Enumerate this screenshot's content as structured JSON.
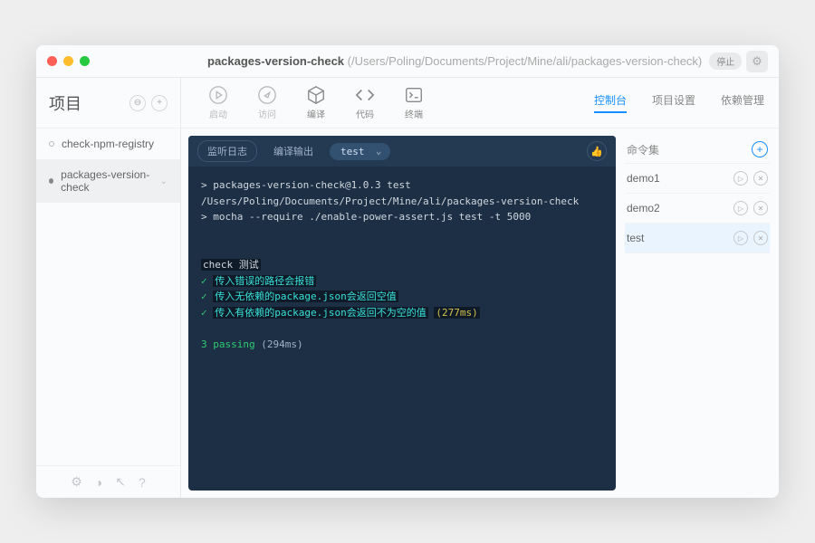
{
  "titlebar": {
    "name": "packages-version-check",
    "path": "(/Users/Poling/Documents/Project/Mine/ali/packages-version-check)",
    "stop": "停止"
  },
  "sidebar": {
    "title": "项目",
    "projects": [
      {
        "name": "check-npm-registry"
      },
      {
        "name": "packages-version-check"
      }
    ]
  },
  "toolbar": {
    "items": [
      {
        "label": "启动"
      },
      {
        "label": "访问"
      },
      {
        "label": "编译"
      },
      {
        "label": "代码"
      },
      {
        "label": "终端"
      }
    ]
  },
  "tabs": [
    {
      "label": "控制台"
    },
    {
      "label": "项目设置"
    },
    {
      "label": "依赖管理"
    }
  ],
  "console": {
    "bar": {
      "log": "监听日志",
      "compile": "编译输出",
      "select": "test"
    },
    "line1": "> packages-version-check@1.0.3 test /Users/Poling/Documents/Project/Mine/ali/packages-version-check",
    "line2": "> mocha --require ./enable-power-assert.js test -t 5000",
    "suite": "check 测试",
    "t1": "传入错误的路径会报错",
    "t2": "传入无依赖的package.json会返回空值",
    "t3": "传入有依赖的package.json会返回不为空的值",
    "t3time": "(277ms)",
    "summary": "3 passing",
    "summaryTime": "(294ms)"
  },
  "right": {
    "title": "命令集",
    "cmds": [
      {
        "name": "demo1"
      },
      {
        "name": "demo2"
      },
      {
        "name": "test"
      }
    ]
  }
}
